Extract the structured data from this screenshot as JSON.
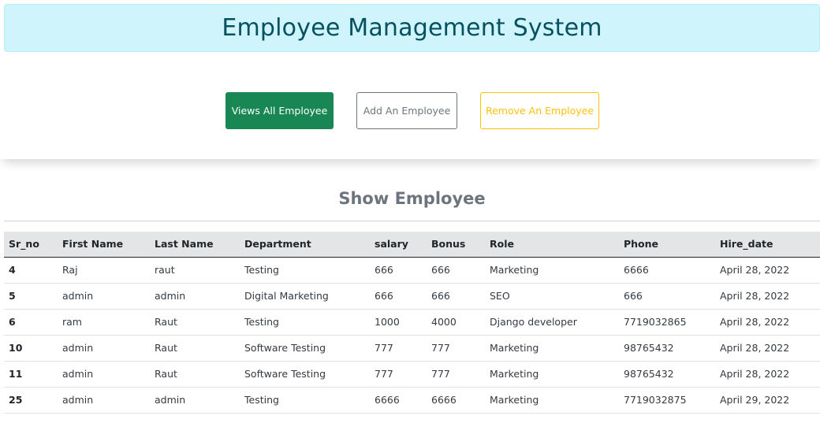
{
  "header": {
    "title": "Employee Management System"
  },
  "nav": {
    "view_label": "Views All Employee",
    "add_label": "Add An Employee",
    "remove_label": "Remove An Employee"
  },
  "colors": {
    "header_bg": "#cff4fc",
    "header_text": "#055160",
    "success": "#198754",
    "secondary": "#6c757d",
    "warning": "#ffc107"
  },
  "section": {
    "title": "Show Employee"
  },
  "table": {
    "columns": [
      "Sr_no",
      "First Name",
      "Last Name",
      "Department",
      "salary",
      "Bonus",
      "Role",
      "Phone",
      "Hire_date"
    ],
    "rows": [
      [
        "4",
        "Raj",
        "raut",
        "Testing",
        "666",
        "666",
        "Marketing",
        "6666",
        "April 28, 2022"
      ],
      [
        "5",
        "admin",
        "admin",
        "Digital Marketing",
        "666",
        "666",
        "SEO",
        "666",
        "April 28, 2022"
      ],
      [
        "6",
        "ram",
        "Raut",
        "Testing",
        "1000",
        "4000",
        "Django developer",
        "7719032865",
        "April 28, 2022"
      ],
      [
        "10",
        "admin",
        "Raut",
        "Software Testing",
        "777",
        "777",
        "Marketing",
        "98765432",
        "April 28, 2022"
      ],
      [
        "11",
        "admin",
        "Raut",
        "Software Testing",
        "777",
        "777",
        "Marketing",
        "98765432",
        "April 28, 2022"
      ],
      [
        "25",
        "admin",
        "admin",
        "Testing",
        "6666",
        "6666",
        "Marketing",
        "7719032875",
        "April 29, 2022"
      ]
    ]
  }
}
